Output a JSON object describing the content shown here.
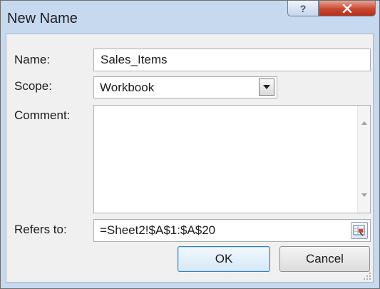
{
  "dialog": {
    "title": "New Name",
    "help_glyph": "?",
    "close_glyph": "x"
  },
  "fields": {
    "name_label": "Name:",
    "name_value": "Sales_Items",
    "scope_label": "Scope:",
    "scope_value": "Workbook",
    "comment_label": "Comment:",
    "comment_value": "",
    "refers_label": "Refers to:",
    "refers_value": "=Sheet2!$A$1:$A$20"
  },
  "buttons": {
    "ok": "OK",
    "cancel": "Cancel"
  },
  "icons": {
    "help": "help-icon",
    "close": "close-icon",
    "dropdown": "chevron-down-icon",
    "collapse": "range-select-icon",
    "scroll_up": "scroll-up-arrow-icon",
    "scroll_down": "scroll-down-arrow-icon",
    "grip": "resize-grip-icon"
  },
  "colors": {
    "title_bar": "#c7d9ef",
    "close_button": "#c9472f",
    "dialog_body": "#f0f0f0",
    "ok_border": "#3c7fb1"
  }
}
